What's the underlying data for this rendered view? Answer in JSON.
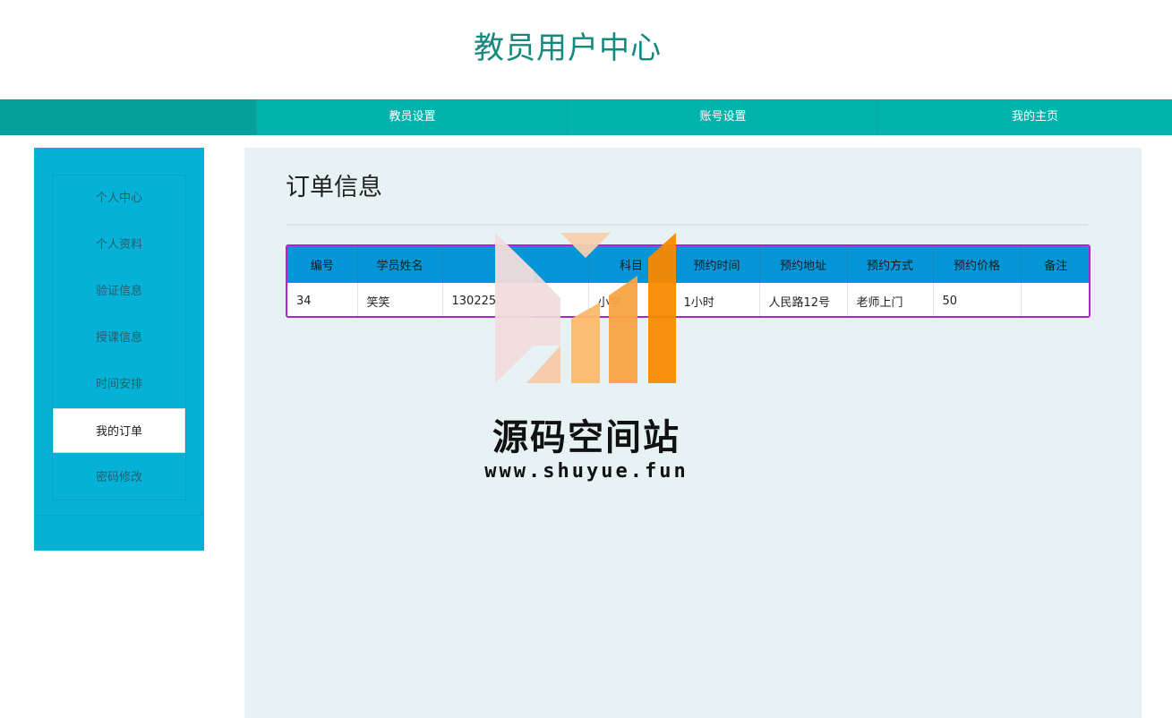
{
  "header": {
    "title": "教员用户中心"
  },
  "topnav": {
    "items": [
      {
        "label": "教员设置"
      },
      {
        "label": "账号设置"
      },
      {
        "label": "我的主页"
      }
    ]
  },
  "sidebar": {
    "items": [
      {
        "label": "个人中心"
      },
      {
        "label": "个人资料"
      },
      {
        "label": "验证信息"
      },
      {
        "label": "授课信息"
      },
      {
        "label": "时间安排"
      },
      {
        "label": "我的订单",
        "active": true
      },
      {
        "label": "密码修改"
      }
    ]
  },
  "main": {
    "heading": "订单信息",
    "table": {
      "columns": [
        "编号",
        "学员姓名",
        "",
        "科目",
        "预约时间",
        "预约地址",
        "预约方式",
        "预约价格",
        "备注"
      ],
      "rows": [
        [
          "34",
          "笑笑",
          "130225",
          "小学",
          "1小时",
          "人民路12号",
          "老师上门",
          "50",
          ""
        ]
      ]
    }
  },
  "watermark": {
    "title": "源码空间站",
    "url": "www.shuyue.fun"
  },
  "colors": {
    "title": "#148a7e",
    "topnav": "#00b4ab",
    "sidebar": "#05b1d6",
    "content_bg": "#e6f2f3",
    "table_header": "#0696d8",
    "table_border": "#b222d2",
    "logo_orange": "#f98a00"
  }
}
